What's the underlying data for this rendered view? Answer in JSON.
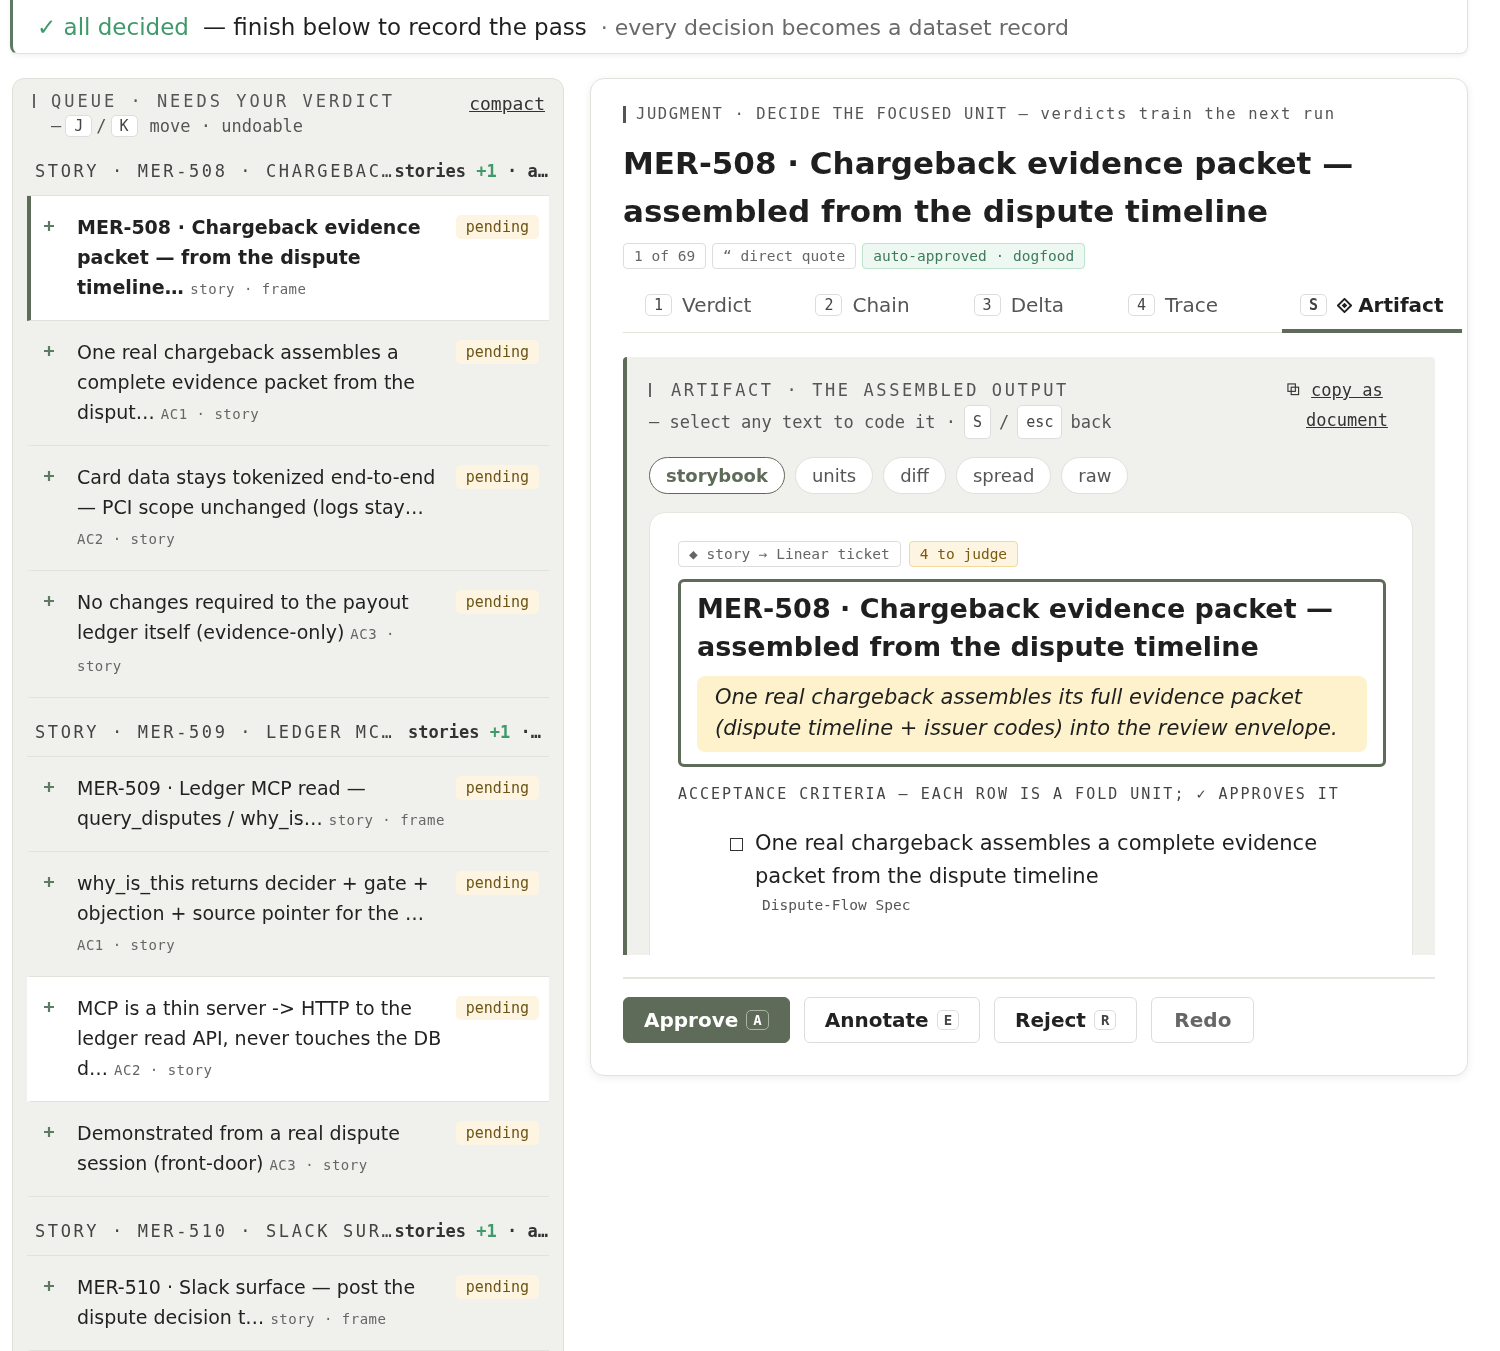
{
  "banner": {
    "status": "✓ all decided",
    "message": "— finish below to record the pass",
    "note": "· every decision becomes a dataset record"
  },
  "queue": {
    "title": "QUEUE · NEEDS YOUR VERDICT",
    "hint_prefix": "—",
    "keys": [
      "J",
      "K"
    ],
    "key_sep": "/",
    "hint_suffix": "move · undoable",
    "compact_link": "compact",
    "groups": [
      {
        "label": "STORY · MER-508 · CHARGEBAC…",
        "count_label": "stories",
        "delta": "+1",
        "tail": "· a…",
        "items": [
          {
            "kind": "story",
            "title": "MER-508 · Chargeback evidence packet — from the dispute timeline…",
            "meta": "story · frame",
            "status": "pending",
            "selected": true,
            "highlighted": true
          },
          {
            "kind": "criterion",
            "title": "One real chargeback assembles a complete evidence packet from the disput…",
            "meta": "AC1 · story",
            "status": "pending",
            "selected": false,
            "highlighted": false
          },
          {
            "kind": "criterion",
            "title": "Card data stays tokenized end-to-end — PCI scope unchanged (logs stay…",
            "meta": "AC2 · story",
            "status": "pending",
            "selected": false,
            "highlighted": false
          },
          {
            "kind": "criterion",
            "title": "No changes required to the payout ledger itself (evidence-only)",
            "meta": "AC3 · story",
            "status": "pending",
            "selected": false,
            "highlighted": false
          }
        ]
      },
      {
        "label": "STORY · MER-509 · LEDGER MC…",
        "count_label": "stories",
        "delta": "+1",
        "tail": "·…",
        "items": [
          {
            "kind": "criterion",
            "title": "MER-509 · Ledger MCP read — query_disputes / why_is…",
            "meta": "story · frame",
            "status": "pending",
            "selected": false,
            "highlighted": false
          },
          {
            "kind": "criterion",
            "title": "why_is_this returns decider + gate + objection + source pointer for the …",
            "meta": "AC1 · story",
            "status": "pending",
            "selected": false,
            "highlighted": false
          },
          {
            "kind": "criterion",
            "title": "MCP is a thin server -> HTTP to the ledger read API, never touches the DB d…",
            "meta": "AC2 · story",
            "status": "pending",
            "selected": false,
            "highlighted": true
          },
          {
            "kind": "criterion",
            "title": "Demonstrated from a real dispute session (front-door)",
            "meta": "AC3 · story",
            "status": "pending",
            "selected": false,
            "highlighted": false
          }
        ]
      },
      {
        "label": "STORY · MER-510 · SLACK SUR…",
        "count_label": "stories",
        "delta": "+1",
        "tail": "· a…",
        "items": [
          {
            "kind": "criterion",
            "title": "MER-510 · Slack surface — post the dispute decision t…",
            "meta": "story · frame",
            "status": "pending",
            "selected": false,
            "highlighted": false
          }
        ]
      }
    ]
  },
  "judgment": {
    "eyebrow": "JUDGMENT · DECIDE THE FOCUSED UNIT — verdicts train the next run",
    "title": "MER-508 · Chargeback evidence packet — assembled from the dispute timeline",
    "chips": [
      {
        "kind": "plain",
        "text": "1 of 69"
      },
      {
        "kind": "plain",
        "text": "“ direct quote"
      },
      {
        "kind": "good",
        "text": "auto-approved · dogfood"
      }
    ],
    "tabs": [
      {
        "key": "1",
        "label": "Verdict",
        "selected": false
      },
      {
        "key": "2",
        "label": "Chain",
        "selected": false
      },
      {
        "key": "3",
        "label": "Delta",
        "selected": false
      },
      {
        "key": "4",
        "label": "Trace",
        "selected": false
      },
      {
        "key": "S",
        "label": "Artifact",
        "selected": true
      }
    ],
    "artifact": {
      "heading": "ARTIFACT · THE ASSEMBLED OUTPUT",
      "hint": "— select any text to code it ·",
      "keys": [
        "S",
        "esc"
      ],
      "key_sep": "/",
      "hint_end": "back",
      "copy_link": "copy as document",
      "views": [
        {
          "label": "storybook",
          "selected": true
        },
        {
          "label": "units",
          "selected": false
        },
        {
          "label": "diff",
          "selected": false
        },
        {
          "label": "spread",
          "selected": false
        },
        {
          "label": "raw",
          "selected": false
        }
      ],
      "source_chip": "◆ story → Linear ticket",
      "count_chip": "4 to judge",
      "story_title": "MER-508 · Chargeback evidence packet — assembled from the dispute timeline",
      "story_quote": "One real chargeback assembles its full evidence packet (dispute timeline + issuer codes) into the review envelope.",
      "criteria_label": "ACCEPTANCE CRITERIA — EACH ROW IS A FOLD UNIT; ✓ APPROVES IT",
      "criteria": [
        {
          "text": "One real chargeback assembles a complete evidence packet from the dispute timeline",
          "source": "Dispute-Flow Spec",
          "checked": false
        }
      ]
    },
    "actions": [
      {
        "kind": "primary",
        "label": "Approve",
        "key": "A"
      },
      {
        "kind": "plain",
        "label": "Annotate",
        "key": "E"
      },
      {
        "kind": "plain",
        "label": "Reject",
        "key": "R"
      },
      {
        "kind": "muted",
        "label": "Redo"
      }
    ]
  }
}
